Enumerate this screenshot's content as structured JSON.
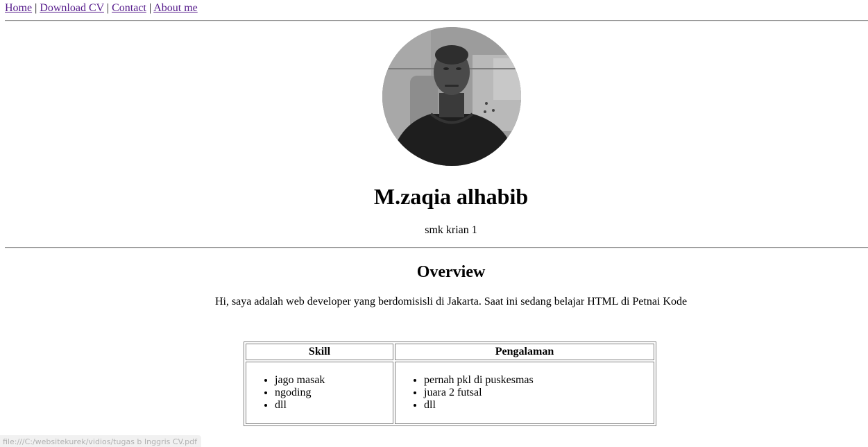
{
  "nav": {
    "home": "Home",
    "download_cv": "Download CV",
    "contact": "Contact",
    "about": "About me",
    "separator": "|"
  },
  "profile": {
    "photo": "profile-photo",
    "name": "M.zaqia alhabib",
    "school": "smk krian 1"
  },
  "overview": {
    "title": "Overview",
    "text": "Hi, saya adalah web developer yang berdomisisli di Jakarta. Saat ini sedang belajar HTML di Petnai Kode"
  },
  "table": {
    "headers": [
      "Skill",
      "Pengalaman"
    ],
    "skills": [
      "jago masak",
      "ngoding",
      "dll"
    ],
    "experience": [
      "pernah pkl di puskesmas",
      "juara 2 futsal",
      "dll"
    ]
  },
  "status_bar": {
    "url": "file:///C:/websitekurek/vidios/tugas b Inggris CV.pdf"
  }
}
